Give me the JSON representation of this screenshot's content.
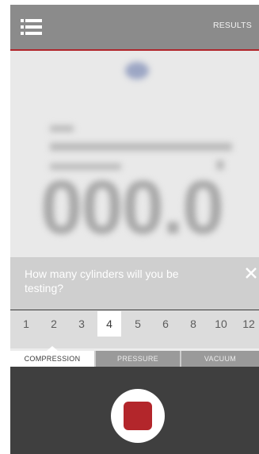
{
  "header": {
    "results_label": "RESULTS",
    "menu_icon": "menu-list-icon"
  },
  "question": {
    "text": "How many cylinders will you be testing?",
    "close_icon": "close-icon"
  },
  "numbers": {
    "options": [
      "1",
      "2",
      "3",
      "4",
      "5",
      "6",
      "8",
      "10",
      "12"
    ],
    "selected": "4"
  },
  "tabs": {
    "items": [
      "COMPRESSION",
      "PRESSURE",
      "VACUUM"
    ],
    "active": "COMPRESSION"
  },
  "record": {
    "icon": "record-stop-icon"
  },
  "gauge": {
    "reading": "000.0"
  },
  "colors": {
    "accent": "#b3262b",
    "topbar": "#8b8b8b",
    "dark_panel": "#3f3f3f"
  }
}
